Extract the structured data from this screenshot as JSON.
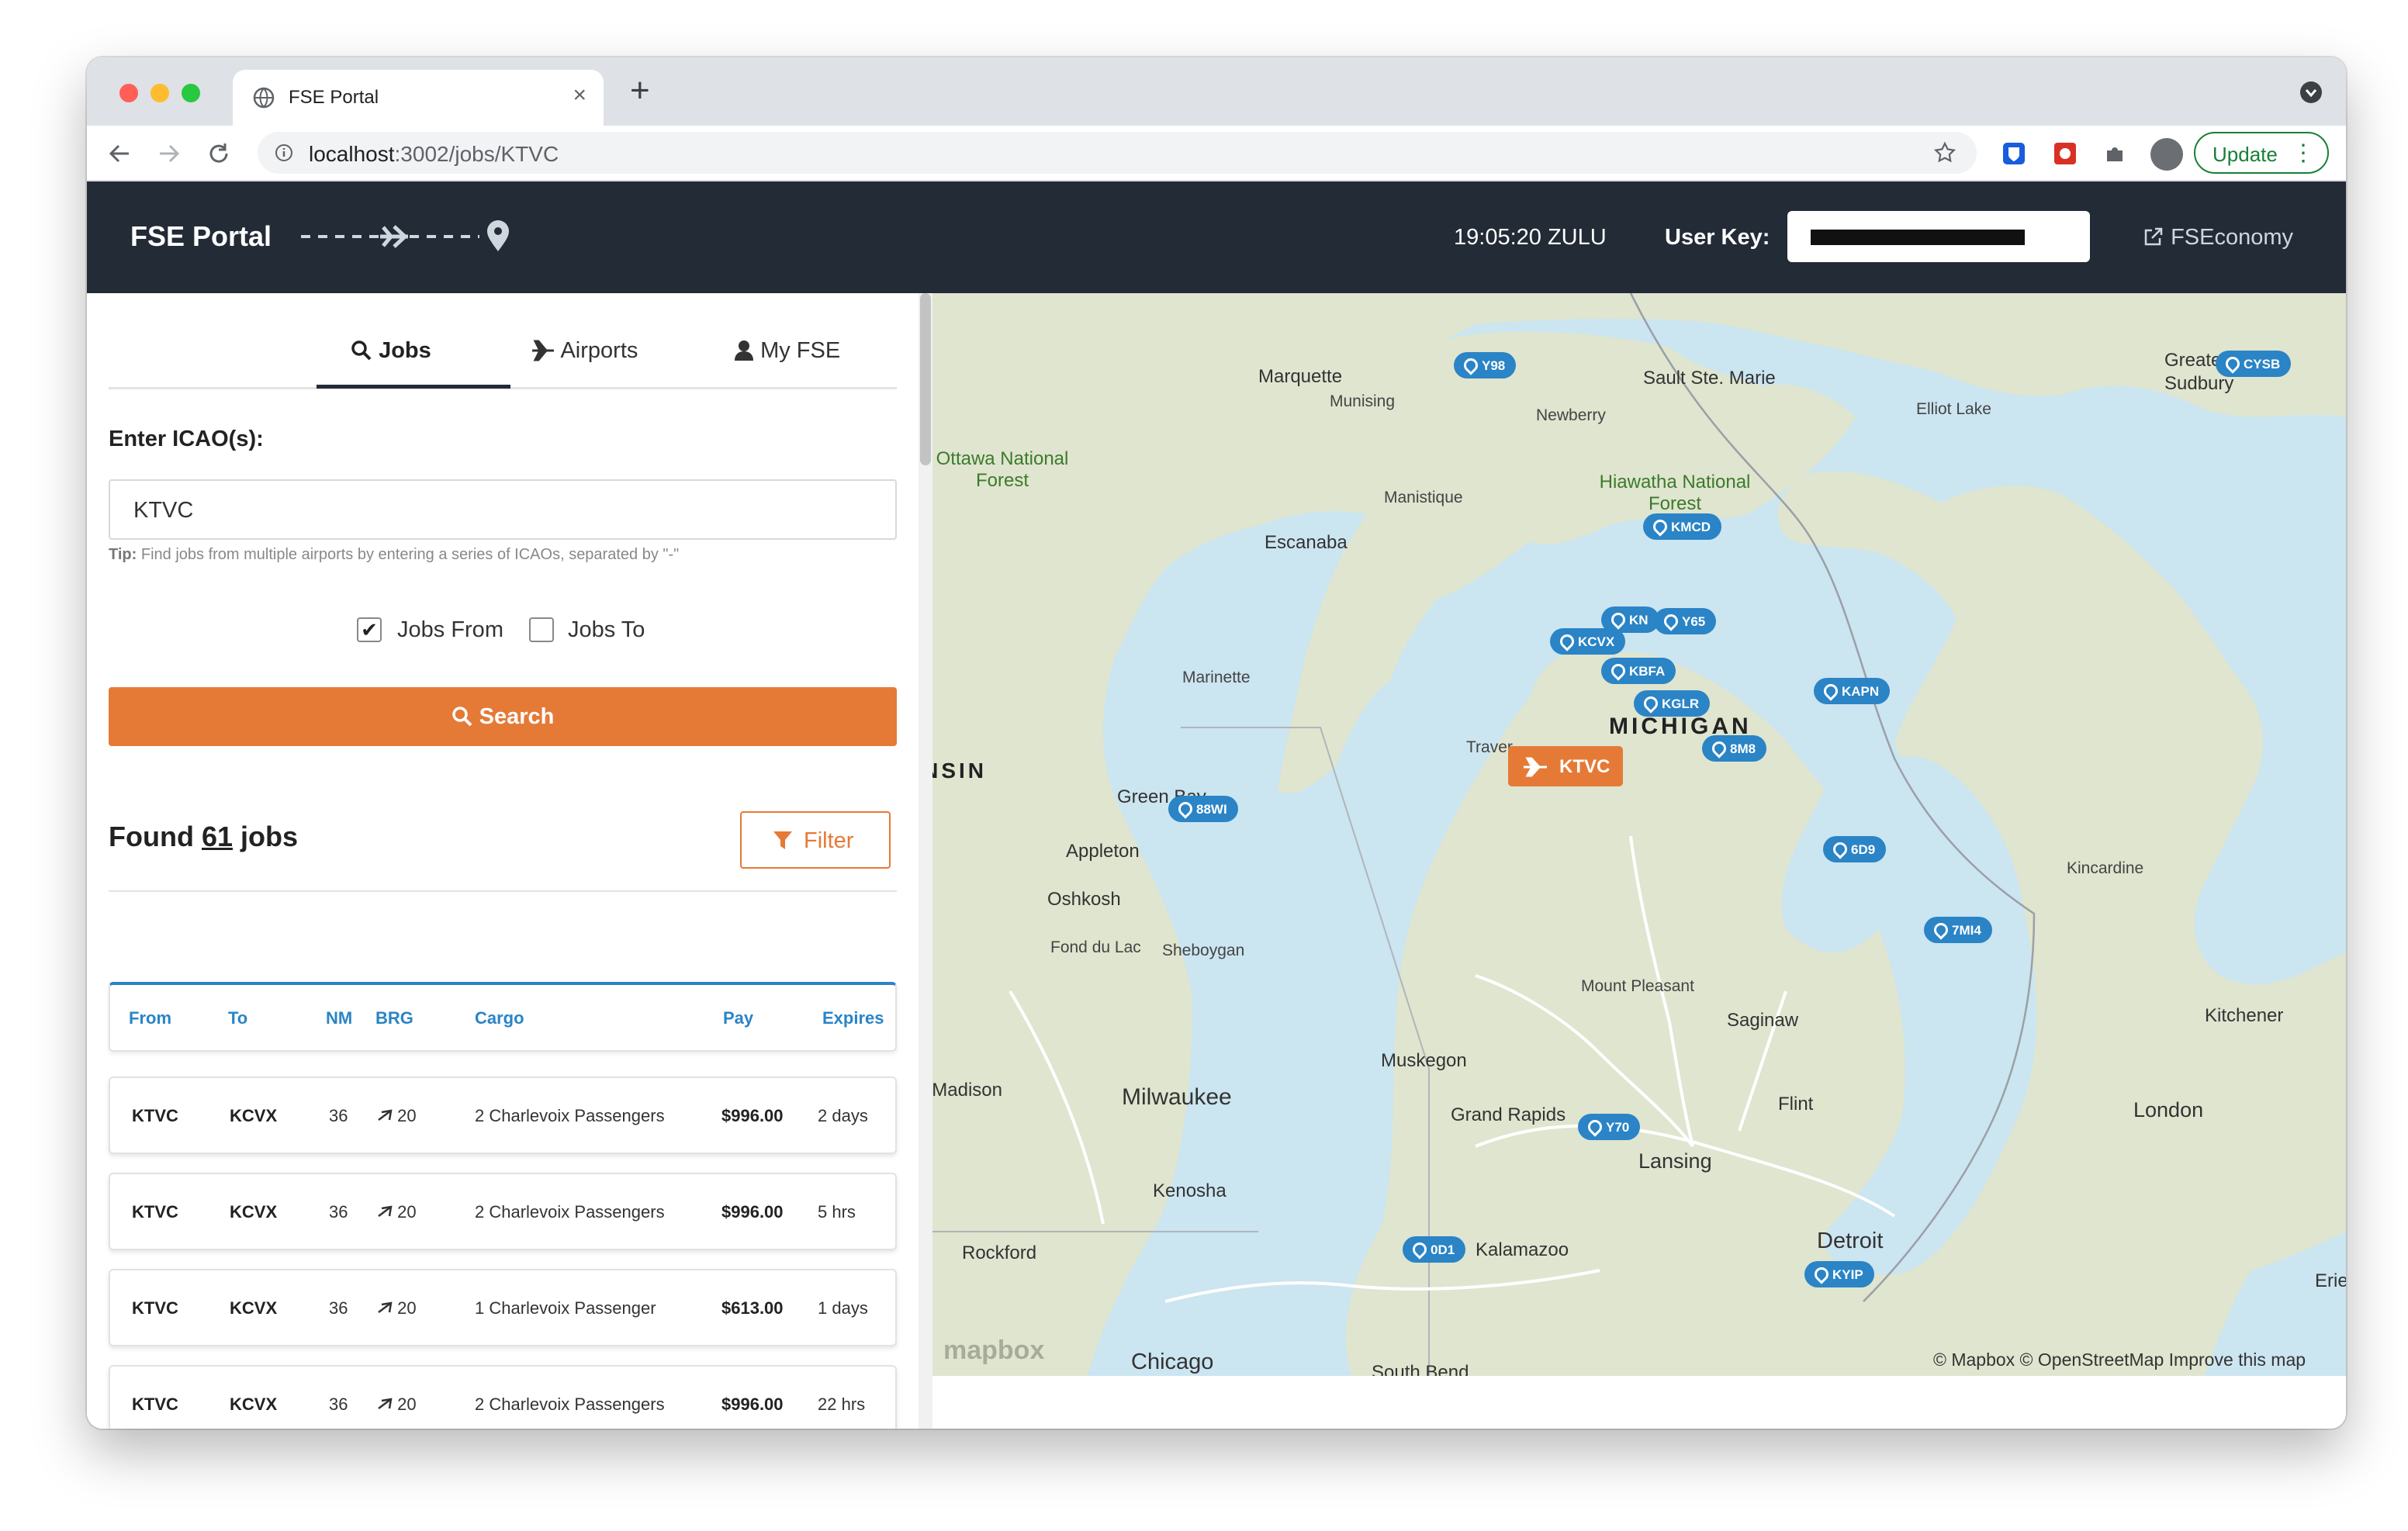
{
  "browser": {
    "tab_title": "FSE Portal",
    "url_host": "localhost",
    "url_rest": ":3002/jobs/KTVC",
    "update_label": "Update"
  },
  "header": {
    "brand": "FSE Portal",
    "clock": "19:05:20  ZULU",
    "user_key_label": "User Key:",
    "user_key_value": "",
    "external_link": "FSEconomy"
  },
  "tabs": [
    "Jobs",
    "Airports",
    "My FSE"
  ],
  "form": {
    "icao_label": "Enter ICAO(s):",
    "icao_value": "KTVC",
    "tip_bold": "Tip:",
    "tip_text": "Find jobs from multiple airports by entering a series of ICAOs, separated by \"-\"",
    "jobs_from_label": "Jobs From",
    "jobs_from_checked": true,
    "jobs_to_label": "Jobs To",
    "jobs_to_checked": false,
    "search_label": "Search"
  },
  "results": {
    "found_prefix": "Found",
    "count": "61",
    "found_suffix": "jobs",
    "filter_label": "Filter"
  },
  "table": {
    "columns": [
      "From",
      "To",
      "NM",
      "BRG",
      "Cargo",
      "Pay",
      "Expires"
    ],
    "rows": [
      {
        "from": "KTVC",
        "to": "KCVX",
        "nm": "36",
        "brg": "20",
        "cargo": "2 Charlevoix Passengers",
        "pay": "$996.00",
        "expires": "2 days"
      },
      {
        "from": "KTVC",
        "to": "KCVX",
        "nm": "36",
        "brg": "20",
        "cargo": "2 Charlevoix Passengers",
        "pay": "$996.00",
        "expires": "5 hrs"
      },
      {
        "from": "KTVC",
        "to": "KCVX",
        "nm": "36",
        "brg": "20",
        "cargo": "1 Charlevoix Passenger",
        "pay": "$613.00",
        "expires": "1 days"
      },
      {
        "from": "KTVC",
        "to": "KCVX",
        "nm": "36",
        "brg": "20",
        "cargo": "2 Charlevoix Passengers",
        "pay": "$996.00",
        "expires": "22 hrs"
      }
    ]
  },
  "map": {
    "current_airport": "KTVC",
    "places": [
      "Marquette",
      "Munising",
      "Sault Ste. Marie",
      "Newberry",
      "Greater Sudbury",
      "Elliot Lake",
      "Ottawa National Forest",
      "Hiawatha National Forest",
      "Manistique",
      "Escanaba",
      "Marinette",
      "Green Bay",
      "Appleton",
      "Oshkosh",
      "Fond du Lac",
      "Sheboygan",
      "MICHIGAN",
      "Traverse City",
      "Kincardine",
      "Mount Pleasant",
      "Saginaw",
      "Muskegon",
      "Grand Rapids",
      "Lansing",
      "Flint",
      "Kitchener",
      "London",
      "Madison",
      "Milwaukee",
      "Kenosha",
      "Rockford",
      "Kalamazoo",
      "Detroit",
      "Chicago",
      "South Bend",
      "Erie",
      "WISCONSIN"
    ],
    "airports": [
      "Y98",
      "CYSB",
      "KMCD",
      "KN",
      "Y65",
      "KCVX",
      "KBFA",
      "KGLR",
      "KAPN",
      "8M8",
      "88WI",
      "6D9",
      "7MI4",
      "Y70",
      "0D1",
      "KYIP"
    ],
    "attribution": "© Mapbox © OpenStreetMap  Improve this map",
    "logo": "mapbox"
  }
}
